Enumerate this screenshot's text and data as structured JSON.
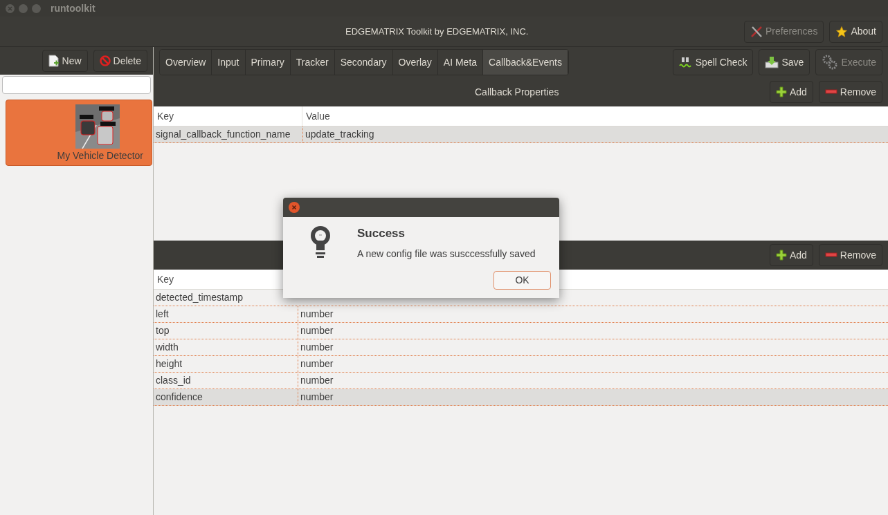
{
  "window": {
    "title": "runtoolkit"
  },
  "header": {
    "title": "EDGEMATRIX Toolkit by EDGEMATRIX, INC.",
    "buttons": [
      {
        "kind": "preferences",
        "label": "Preferences",
        "disabled": true
      },
      {
        "kind": "about",
        "label": "About",
        "disabled": false
      }
    ]
  },
  "sidebar": {
    "buttons": [
      {
        "kind": "new",
        "label": "New"
      },
      {
        "kind": "delete",
        "label": "Delete"
      }
    ],
    "items": [
      {
        "label": "My Vehicle Detector",
        "selected": true,
        "kind": "picture"
      }
    ]
  },
  "tabs": [
    {
      "label": "Overview",
      "selected": false
    },
    {
      "label": "Input",
      "selected": false
    },
    {
      "label": "Primary",
      "selected": false
    },
    {
      "label": "Tracker",
      "selected": false
    },
    {
      "label": "Secondary",
      "selected": false
    },
    {
      "label": "Overlay",
      "selected": false
    },
    {
      "label": "AI Meta",
      "selected": false
    },
    {
      "label": "Callback&Events",
      "selected": true
    }
  ],
  "toolbar": [
    {
      "kind": "spell",
      "label": "Spell Check",
      "disabled": false
    },
    {
      "kind": "save",
      "label": "Save",
      "disabled": false
    },
    {
      "kind": "execute",
      "label": "Execute",
      "disabled": true
    }
  ],
  "sections": [
    {
      "title": "Callback Properties",
      "buttons": [
        {
          "kind": "add",
          "label": "Add"
        },
        {
          "kind": "remove",
          "label": "Remove"
        }
      ],
      "columns": [
        "Key",
        "Value"
      ],
      "rows": [
        {
          "cells": [
            "signal_callback_function_name",
            "update_tracking"
          ],
          "selected": true
        }
      ]
    },
    {
      "buttons": [
        {
          "kind": "add",
          "label": "Add"
        },
        {
          "kind": "remove",
          "label": "Remove"
        }
      ],
      "columns": [
        "Key"
      ],
      "rows": [
        {
          "cells": [
            "detected_timestamp"
          ],
          "selected": false
        },
        {
          "cells": [
            "left",
            "number"
          ],
          "selected": false
        },
        {
          "cells": [
            "top",
            "number"
          ],
          "selected": false
        },
        {
          "cells": [
            "width",
            "number"
          ],
          "selected": false
        },
        {
          "cells": [
            "height",
            "number"
          ],
          "selected": false
        },
        {
          "cells": [
            "class_id",
            "number"
          ],
          "selected": false
        },
        {
          "cells": [
            "confidence",
            "number"
          ],
          "selected": true
        }
      ]
    }
  ],
  "dialog": {
    "title": "Success",
    "message": "A new config file was susccessfully saved",
    "button": "OK"
  }
}
